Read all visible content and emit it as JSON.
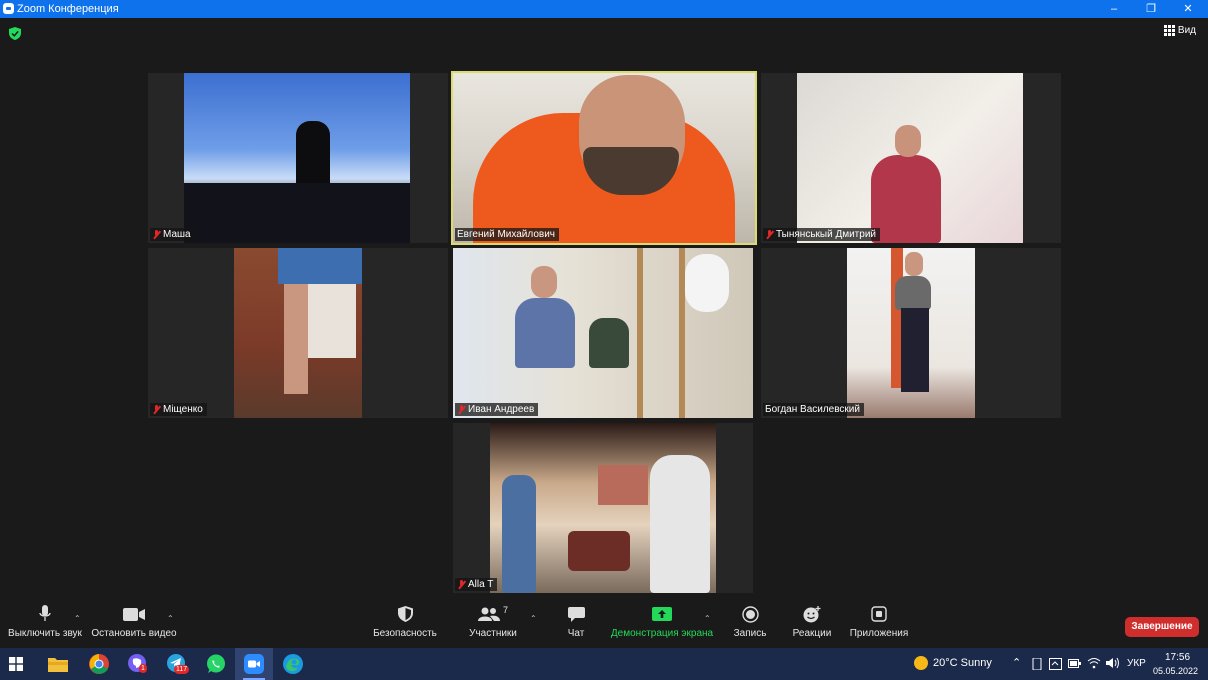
{
  "window": {
    "title": "Zoom Конференция",
    "minimize": "–",
    "maximize": "❐",
    "close": "✕"
  },
  "view_button": {
    "label": "Вид"
  },
  "participants": [
    {
      "name": "Маша",
      "muted": true
    },
    {
      "name": "Евгений Михайлович",
      "muted": false,
      "active_speaker": true
    },
    {
      "name": "Тынянськый Дмитрий",
      "muted": true
    },
    {
      "name": "Міщенко",
      "muted": true
    },
    {
      "name": "Иван Андреев",
      "muted": true
    },
    {
      "name": "Богдан Василевский",
      "muted": false
    },
    {
      "name": "Alla T",
      "muted": true
    }
  ],
  "toolbar": {
    "mute": "Выключить звук",
    "stop_video": "Остановить видео",
    "security": "Безопасность",
    "participants": "Участники",
    "participants_count": "7",
    "chat": "Чат",
    "share_screen": "Демонстрация экрана",
    "record": "Запись",
    "reactions": "Реакции",
    "apps": "Приложения",
    "end": "Завершение"
  },
  "taskbar": {
    "viber_badge": "1",
    "telegram_badge": "117",
    "weather": "20°C  Sunny",
    "language": "УКР",
    "time": "17:56",
    "date": "05.05.2022"
  },
  "colors": {
    "title_bar": "#0e72ed",
    "share_green": "#23d959",
    "end_red": "#d02d2d",
    "active_outline": "#dcdc6e",
    "muted_red": "#e02828",
    "taskbar": "#1b2a4a"
  }
}
